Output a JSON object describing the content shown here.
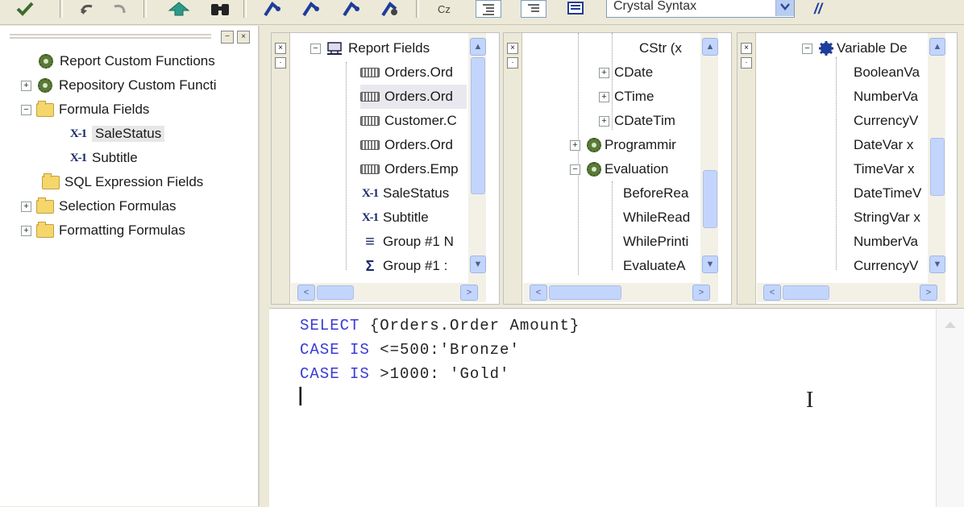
{
  "toolbar": {
    "syntax_select_value": "Crystal Syntax",
    "buttons": [
      "check-icon",
      "undo-icon",
      "redo-icon",
      "arrows-icon",
      "binoculars-icon",
      "bookmark-icon",
      "next-bookmark-icon",
      "prev-bookmark-icon",
      "clear-bookmarks-icon",
      "sort-icon",
      "expand-tree-icon",
      "collapse-tree-icon",
      "properties-icon",
      "comment-icon"
    ],
    "comment_glyph": "//"
  },
  "left_tree": {
    "header_buttons": [
      "−",
      "×"
    ],
    "items": [
      {
        "label": "Report Custom Functions",
        "icon": "gear-icon",
        "expander": ""
      },
      {
        "label": "Repository Custom Functi",
        "icon": "gear-icon",
        "expander": "+"
      },
      {
        "label": "Formula Fields",
        "icon": "folder-icon",
        "expander": "−"
      },
      {
        "label": "SaleStatus",
        "icon": "formula-icon",
        "icon_text": "X-1",
        "expander": ""
      },
      {
        "label": "Subtitle",
        "icon": "formula-icon",
        "icon_text": "X-1",
        "expander": ""
      },
      {
        "label": "SQL Expression Fields",
        "icon": "folder-icon",
        "expander": ""
      },
      {
        "label": "Selection Formulas",
        "icon": "folder-icon",
        "expander": "+"
      },
      {
        "label": "Formatting Formulas",
        "icon": "folder-icon",
        "expander": "+"
      }
    ]
  },
  "fields_pane": {
    "root_label": "Report Fields",
    "items": [
      {
        "label": "Orders.Ord",
        "icon": "database-field-icon"
      },
      {
        "label": "Orders.Ord",
        "icon": "database-field-icon"
      },
      {
        "label": "Customer.C",
        "icon": "database-field-icon"
      },
      {
        "label": "Orders.Ord",
        "icon": "database-field-icon"
      },
      {
        "label": "Orders.Emp",
        "icon": "database-field-icon"
      },
      {
        "label": "SaleStatus",
        "icon": "formula-icon",
        "icon_text": "X-1"
      },
      {
        "label": "Subtitle",
        "icon": "formula-icon",
        "icon_text": "X-1"
      },
      {
        "label": "Group #1 N",
        "icon": "group-icon",
        "icon_text": "≡"
      },
      {
        "label": "Group #1 :",
        "icon": "sum-icon",
        "icon_text": "Σ"
      }
    ]
  },
  "functions_pane": {
    "items": [
      {
        "label": "CStr (x",
        "expander": ""
      },
      {
        "label": "CDate",
        "expander": "+"
      },
      {
        "label": "CTime",
        "expander": "+"
      },
      {
        "label": "CDateTim",
        "expander": "+"
      },
      {
        "label": "Programmir",
        "expander": "+",
        "icon": "gear-icon"
      },
      {
        "label": "Evaluation",
        "expander": "−",
        "icon": "gear-icon"
      },
      {
        "label": "BeforeRea",
        "expander": ""
      },
      {
        "label": "WhileRead",
        "expander": ""
      },
      {
        "label": "WhilePrinti",
        "expander": ""
      },
      {
        "label": "EvaluateA",
        "expander": ""
      }
    ]
  },
  "operators_pane": {
    "root_label": "Variable De",
    "items": [
      "BooleanVa",
      "NumberVa",
      "CurrencyV",
      "DateVar x",
      "TimeVar x",
      "DateTimeV",
      "StringVar x",
      "NumberVa",
      "CurrencyV"
    ]
  },
  "pane_strip_buttons": [
    "×",
    "·"
  ],
  "scroll_arrows": {
    "up": "▲",
    "down": "▼",
    "left": "<",
    "right": ">"
  },
  "editor": {
    "lines": [
      {
        "kw": "SELECT",
        "rest": " {Orders.Order Amount}"
      },
      {
        "kw": "CASE IS",
        "rest": " <=500:'Bronze'"
      },
      {
        "kw": "CASE IS",
        "rest": " >1000: 'Gold'"
      }
    ],
    "cursor_char": "▏",
    "ibeam_glyph": "I"
  }
}
